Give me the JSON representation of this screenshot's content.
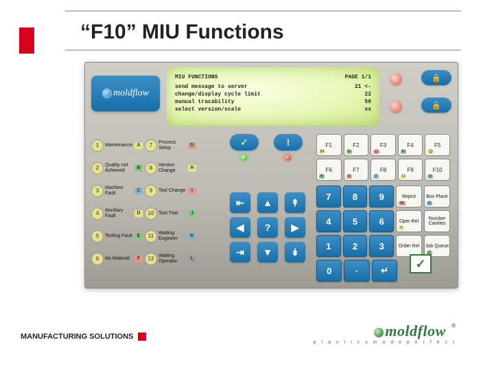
{
  "title": "“F10” MIU Functions",
  "terminal": {
    "header_left": "MIU FUNCTIONS",
    "header_right": "PAGE 1/1",
    "lines": [
      {
        "text": "send message to server",
        "code": "21 <-"
      },
      {
        "text": "change/display cycle limit",
        "code": "22"
      },
      {
        "text": "manual tracability",
        "code": "50"
      },
      {
        "text": "select version/scale",
        "code": "xx"
      }
    ]
  },
  "logo_text": "moldflow",
  "left_keys": [
    {
      "n": "1",
      "label": "Maintenance",
      "cap": "A",
      "cls": "y",
      "n2": "7",
      "label2": "Process Setup",
      "cap2": "G",
      "cls2": "r"
    },
    {
      "n": "2",
      "label": "Quality not Achieved",
      "cap": "B",
      "cls": "g",
      "n2": "8",
      "label2": "Version Change",
      "cap2": "H",
      "cls2": "y"
    },
    {
      "n": "3",
      "label": "Machine Fault",
      "cap": "C",
      "cls": "b",
      "n2": "9",
      "label2": "Tool Change",
      "cap2": "I",
      "cls2": "r"
    },
    {
      "n": "4",
      "label": "Ancillary Fault",
      "cap": "D",
      "cls": "y",
      "n2": "10",
      "label2": "Tool Trial",
      "cap2": "J",
      "cls2": "g"
    },
    {
      "n": "5",
      "label": "Tooling Fault",
      "cap": "E",
      "cls": "g",
      "n2": "11",
      "label2": "Waiting Engineer",
      "cap2": "K",
      "cls2": "b"
    },
    {
      "n": "6",
      "label": "No Material",
      "cap": "F",
      "cls": "r",
      "n2": "12",
      "label2": "Waiting Operator",
      "cap2": "L",
      "cls2": "k"
    }
  ],
  "mid": {
    "ok": "✓",
    "warn": "!"
  },
  "fkeys": {
    "row1": [
      {
        "t": "F1",
        "c": "M",
        "cc": "y"
      },
      {
        "t": "F2",
        "c": "N",
        "cc": "g"
      },
      {
        "t": "F3",
        "c": "O",
        "cc": "r"
      },
      {
        "t": "F4",
        "c": "P",
        "cc": "b"
      },
      {
        "t": "F5",
        "c": "Q",
        "cc": "y"
      }
    ],
    "row2": [
      {
        "t": "F6",
        "c": "R",
        "cc": "g"
      },
      {
        "t": "F7",
        "c": "S",
        "cc": "r"
      },
      {
        "t": "F8",
        "c": "T",
        "cc": "b"
      },
      {
        "t": "F9",
        "c": "U",
        "cc": "y"
      },
      {
        "t": "F10",
        "c": "V",
        "cc": "g"
      }
    ]
  },
  "numpad": {
    "r1": [
      "7",
      "8",
      "9"
    ],
    "r2": [
      "4",
      "5",
      "6"
    ],
    "r3": [
      "1",
      "2",
      "3"
    ],
    "r4": [
      "0",
      "·",
      "↵"
    ],
    "side1": [
      {
        "t": "Reject",
        "c": "W",
        "cc": "r"
      },
      {
        "t": "Box Place",
        "c": "X",
        "cc": "b"
      }
    ],
    "side2": [
      {
        "t": "Oper Rel",
        "c": "Y",
        "cc": "y"
      },
      {
        "t": "Number Cavities",
        "c": "",
        "cc": "g"
      }
    ],
    "side3": [
      {
        "t": "Order Rel",
        "c": "",
        "cc": "r"
      },
      {
        "t": "Job Queue",
        "c": "Z",
        "cc": "g"
      }
    ]
  },
  "dpad": {
    "up": "▲",
    "down": "▼",
    "left": "◀",
    "right": "▶",
    "center": "?",
    "pgup": "↟",
    "pgdn": "↡",
    "home": "⇤",
    "end": "⇥"
  },
  "lock": {
    "locked": "🔒",
    "unlocked": "🔓"
  },
  "footer": "MANUFACTURING SOLUTIONS",
  "brand": {
    "name": "moldflow",
    "tag": "p l a s t i c s   m a d e   p e r f e c t",
    "reg": "®"
  },
  "callout_check": "✓"
}
